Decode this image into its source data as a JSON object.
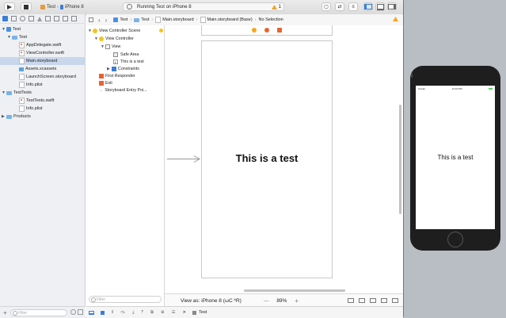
{
  "toolbar": {
    "scheme": "Test",
    "device": "iPhone 8",
    "status": "Running Test on iPhone 8",
    "warning_count": "1"
  },
  "navigator": {
    "filter_placeholder": "Filter",
    "items": [
      {
        "label": "Test"
      },
      {
        "label": "Test"
      },
      {
        "label": "AppDelegate.swift"
      },
      {
        "label": "ViewController.swift"
      },
      {
        "label": "Main.storyboard"
      },
      {
        "label": "Assets.xcassets"
      },
      {
        "label": "LaunchScreen.storyboard"
      },
      {
        "label": "Info.plist"
      },
      {
        "label": "TestTests"
      },
      {
        "label": "TestTests.swift"
      },
      {
        "label": "Info.plist"
      },
      {
        "label": "Products"
      }
    ]
  },
  "jumpbar": {
    "crumbs": [
      "Test",
      "Test",
      "Main.storyboard",
      "Main.storyboard (Base)",
      "No Selection"
    ]
  },
  "outline": {
    "filter_placeholder": "Filter",
    "items": [
      {
        "label": "View Controller Scene"
      },
      {
        "label": "View Controller"
      },
      {
        "label": "View"
      },
      {
        "label": "Safe Area"
      },
      {
        "label": "This is a test"
      },
      {
        "label": "Constraints"
      },
      {
        "label": "First Responder"
      },
      {
        "label": "Exit"
      },
      {
        "label": "Storyboard Entry Poi..."
      }
    ]
  },
  "canvas": {
    "label_text": "This is a test",
    "view_as": "View as: iPhone 8 (ωC ʰR)",
    "zoom_minus": "—",
    "zoom": "89%",
    "zoom_plus": "+"
  },
  "debug": {
    "target": "Test"
  },
  "simulator": {
    "carrier": "Carrier",
    "time": "12:19 PM",
    "label_text": "This is a test"
  },
  "colors": {
    "accent": "#4a90e2",
    "selection": "#c8d7ec",
    "warning": "#f5a623",
    "swift": "#f05138"
  }
}
